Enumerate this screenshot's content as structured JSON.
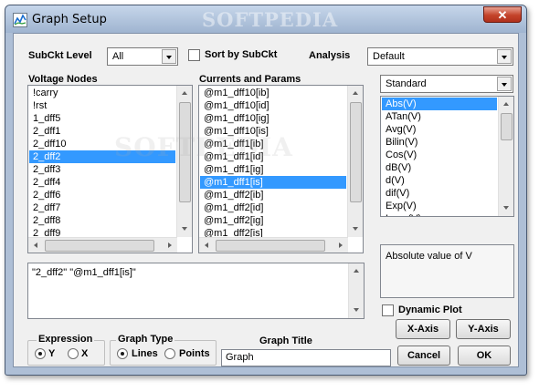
{
  "window": {
    "title": "Graph Setup",
    "close_label": "✕"
  },
  "watermark": {
    "text": "SOFTPEDIA"
  },
  "top_bar": {
    "subckt_level_label": "SubCkt Level",
    "subckt_level_value": "All",
    "sort_by_subckt_label": "Sort by SubCkt",
    "sort_by_subckt_checked": false,
    "analysis_label": "Analysis",
    "analysis_value": "Default"
  },
  "voltage_nodes": {
    "header": "Voltage Nodes",
    "items": [
      "!carry",
      "!rst",
      "1_dff5",
      "2_dff1",
      "2_dff10",
      "2_dff2",
      "2_dff3",
      "2_dff4",
      "2_dff6",
      "2_dff7",
      "2_dff8",
      "2_dff9"
    ],
    "selected_index": 5
  },
  "currents_params": {
    "header": "Currents and Params",
    "items": [
      "@m1_dff10[ib]",
      "@m1_dff10[id]",
      "@m1_dff10[ig]",
      "@m1_dff10[is]",
      "@m1_dff1[ib]",
      "@m1_dff1[id]",
      "@m1_dff1[ig]",
      "@m1_dff1[is]",
      "@m1_dff2[ib]",
      "@m1_dff2[id]",
      "@m1_dff2[ig]",
      "@m1_dff2[is]"
    ],
    "selected_index": 7
  },
  "functions": {
    "category_value": "Standard",
    "items": [
      "Abs(V)",
      "ATan(V)",
      "Avg(V)",
      "Bilin(V)",
      "Cos(V)",
      "dB(V)",
      "d(V)",
      "dif(V)",
      "Exp(V)",
      "Imag(V)"
    ],
    "selected_index": 0,
    "description": "Absolute value of V"
  },
  "expression_text": "\"2_dff2\" \"@m1_dff1[is]\"",
  "dynamic_plot": {
    "label": "Dynamic Plot",
    "checked": false
  },
  "buttons": {
    "x_axis": "X-Axis",
    "y_axis": "Y-Axis",
    "cancel": "Cancel",
    "ok": "OK"
  },
  "expression_group": {
    "title": "Expression",
    "options": [
      "Y",
      "X"
    ],
    "selected": "Y"
  },
  "graph_type_group": {
    "title": "Graph Type",
    "options": [
      "Lines",
      "Points"
    ],
    "selected": "Lines"
  },
  "graph_title": {
    "label": "Graph Title",
    "value": "Graph"
  }
}
